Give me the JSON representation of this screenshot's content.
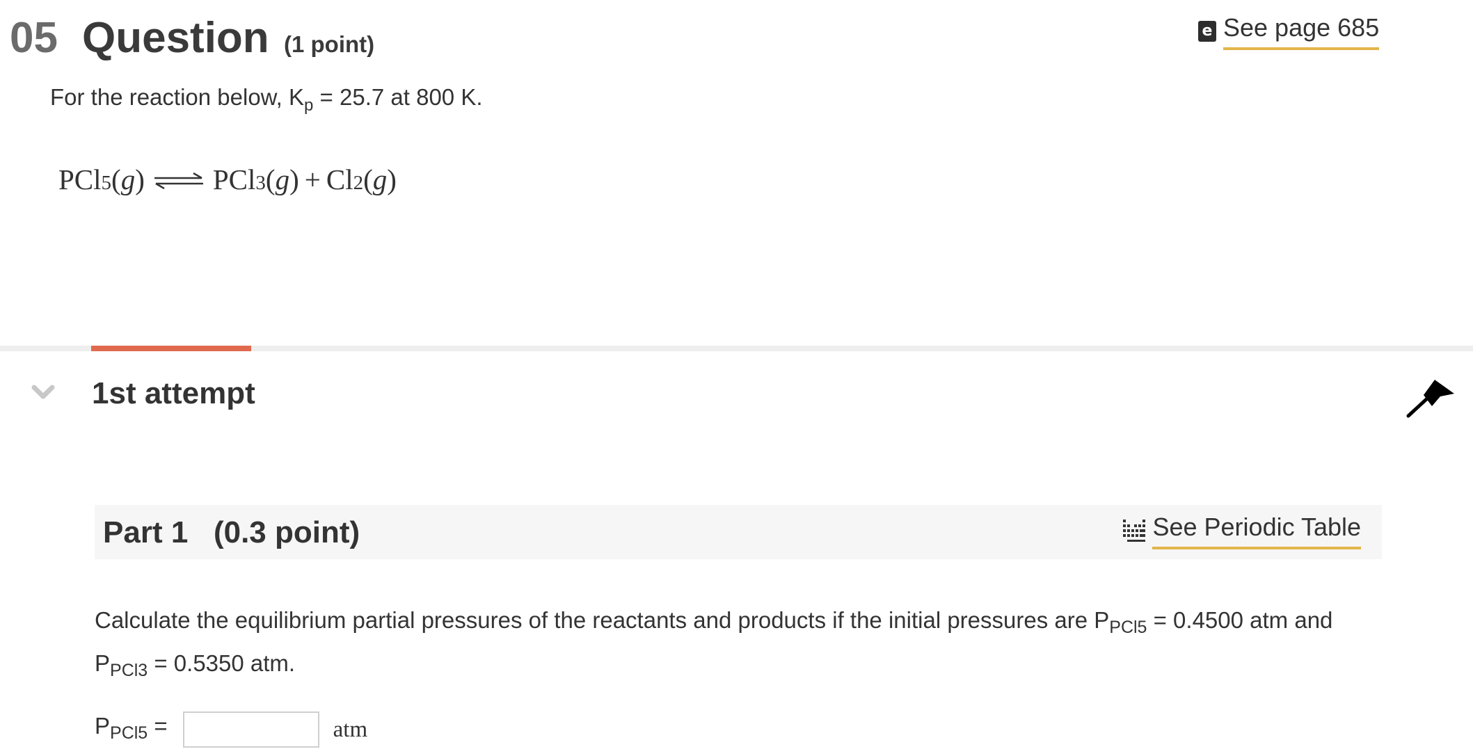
{
  "header": {
    "number": "05",
    "title": "Question",
    "points": "(1 point)",
    "see_page_icon": "ebook-icon",
    "see_page_icon_glyph": "e",
    "see_page_label": "See page 685"
  },
  "intro": {
    "prefix": "For the reaction below, K",
    "sub": "p",
    "suffix": " = 25.7 at 800 K."
  },
  "equation": {
    "reactant": "PCl",
    "reactant_sub": "5",
    "reactant_state": "g",
    "arrow": "equilibrium-arrow",
    "product1": "PCl",
    "product1_sub": "3",
    "product1_state": "g",
    "plus": "+",
    "product2": "Cl",
    "product2_sub": "2",
    "product2_state": "g"
  },
  "attempt": {
    "title": "1st attempt",
    "progress_fraction": 0.11,
    "colors": {
      "progress": "#e06a4e",
      "track": "#eeeeee"
    }
  },
  "part": {
    "title": "Part 1   (0.3 point)",
    "periodic_icon": "periodic-table-icon",
    "periodic_label": "See Periodic Table",
    "link_underline_color": "#e3b54a"
  },
  "question": {
    "text1": "Calculate the equilibrium partial pressures of the reactants and products if the initial pressures are P",
    "sub1": "PCl5",
    "text2": " = 0.4500 atm and P",
    "sub2": "PCl3",
    "text3": " = 0.5350  atm."
  },
  "answer": {
    "label_main": "P",
    "label_sub": "PCl5",
    "label_eq": " =",
    "value": "",
    "unit": "atm"
  }
}
